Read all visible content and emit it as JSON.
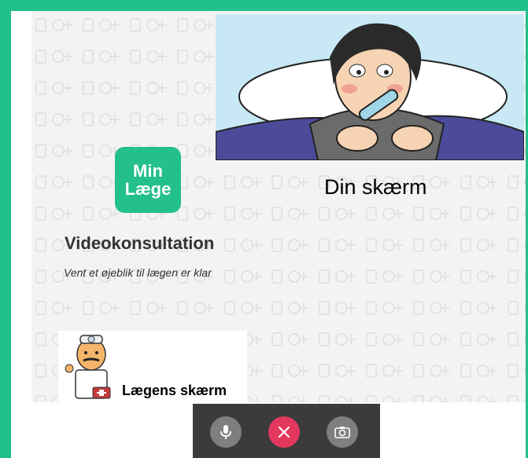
{
  "app": {
    "logo_line1": "Min",
    "logo_line2": "Læge",
    "title": "Videokonsultation",
    "subtitle": "Vent et øjeblik til lægen er klar"
  },
  "self_view": {
    "label": "Din skærm",
    "image": "sick-person-in-bed-with-thermometer"
  },
  "doctor_view": {
    "label": "Lægens skærm",
    "image": "cartoon-doctor"
  },
  "controls": {
    "mic_icon": "microphone-icon",
    "hangup_icon": "close-icon",
    "camera_icon": "camera-switch-icon"
  },
  "colors": {
    "brand": "#22c08a",
    "hangup": "#e3385e"
  }
}
